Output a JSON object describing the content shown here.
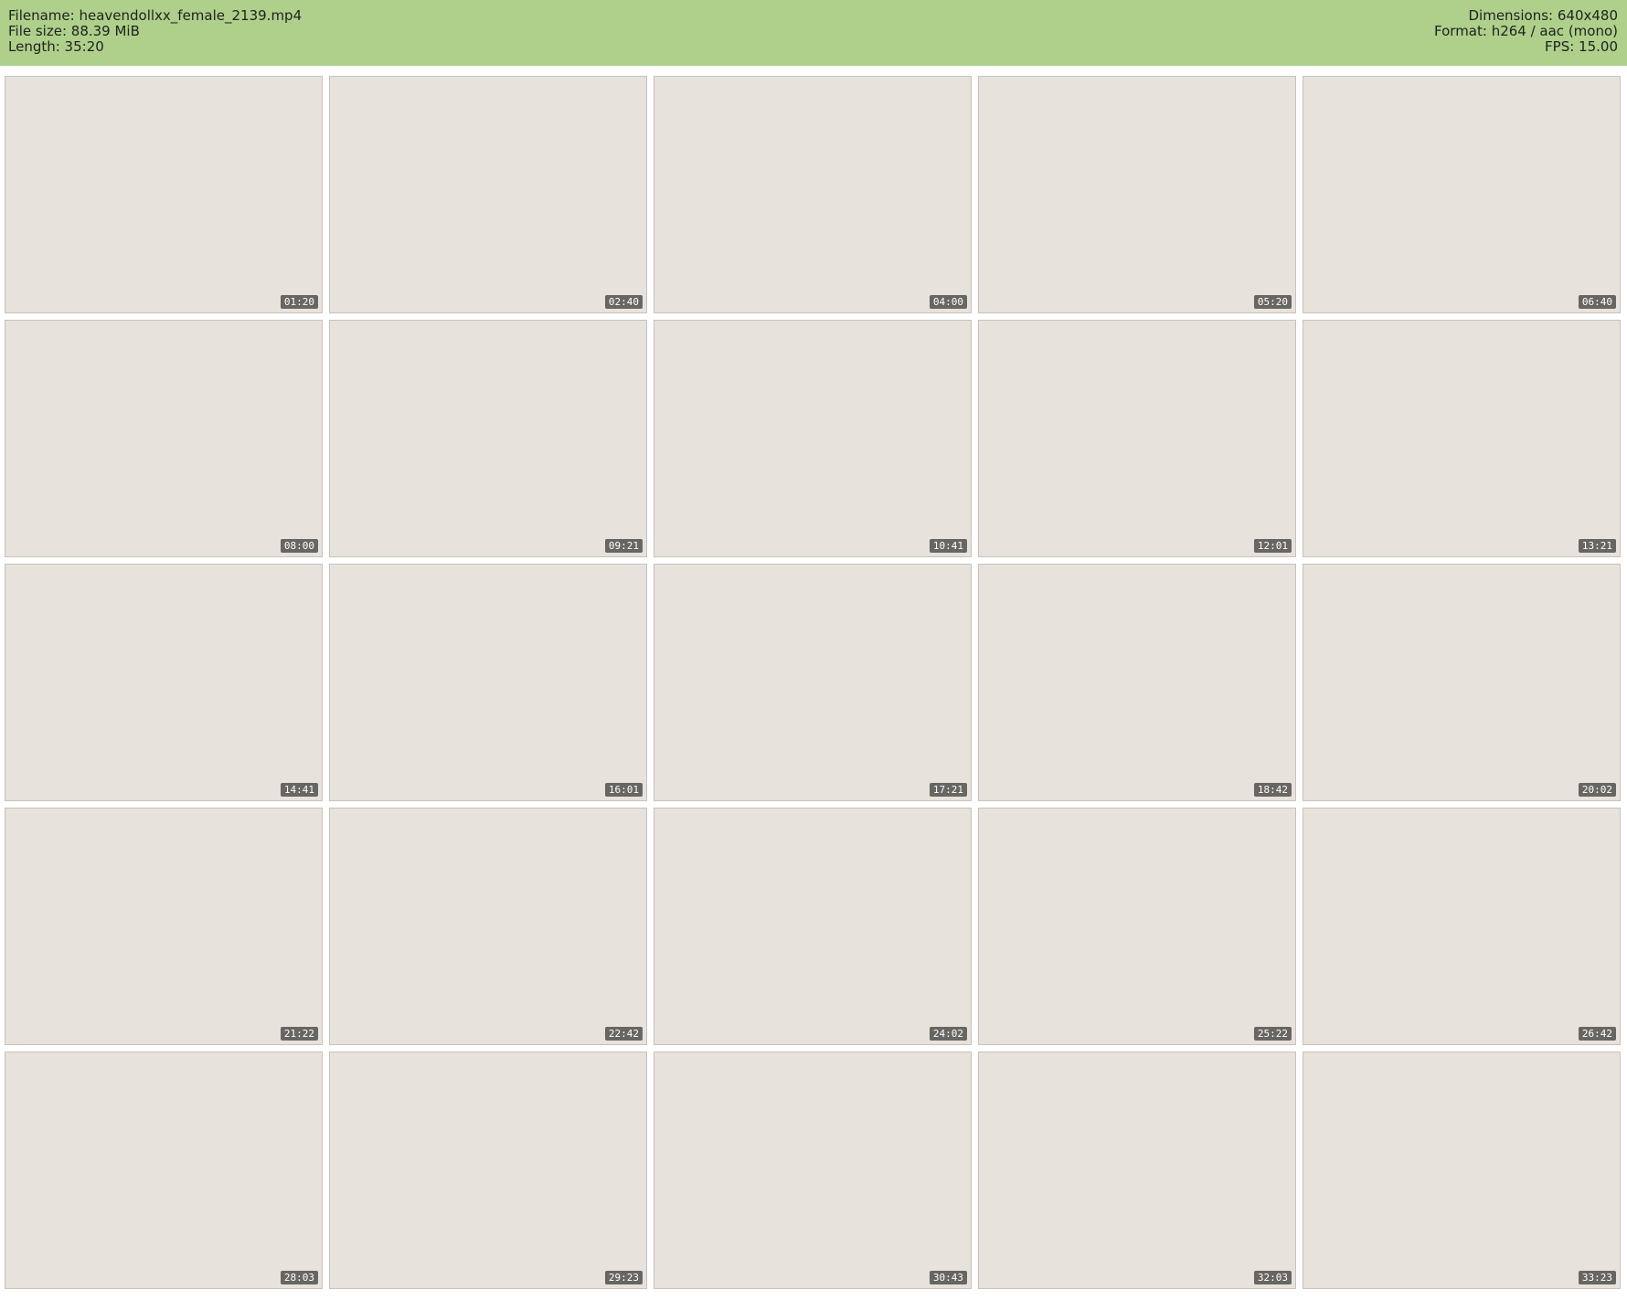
{
  "header": {
    "filename": "Filename: heavendollxx_female_2139.mp4",
    "filesize": "File size: 88.39 MiB",
    "length": "Length: 35:20",
    "dimensions": "Dimensions: 640x480",
    "format": "Format: h264 / aac (mono)",
    "fps": "FPS: 15.00"
  },
  "thumbnails": [
    "01:20",
    "02:40",
    "04:00",
    "05:20",
    "06:40",
    "08:00",
    "09:21",
    "10:41",
    "12:01",
    "13:21",
    "14:41",
    "16:01",
    "17:21",
    "18:42",
    "20:02",
    "21:22",
    "22:42",
    "24:02",
    "25:22",
    "26:42",
    "28:03",
    "29:23",
    "30:43",
    "32:03",
    "33:23"
  ]
}
